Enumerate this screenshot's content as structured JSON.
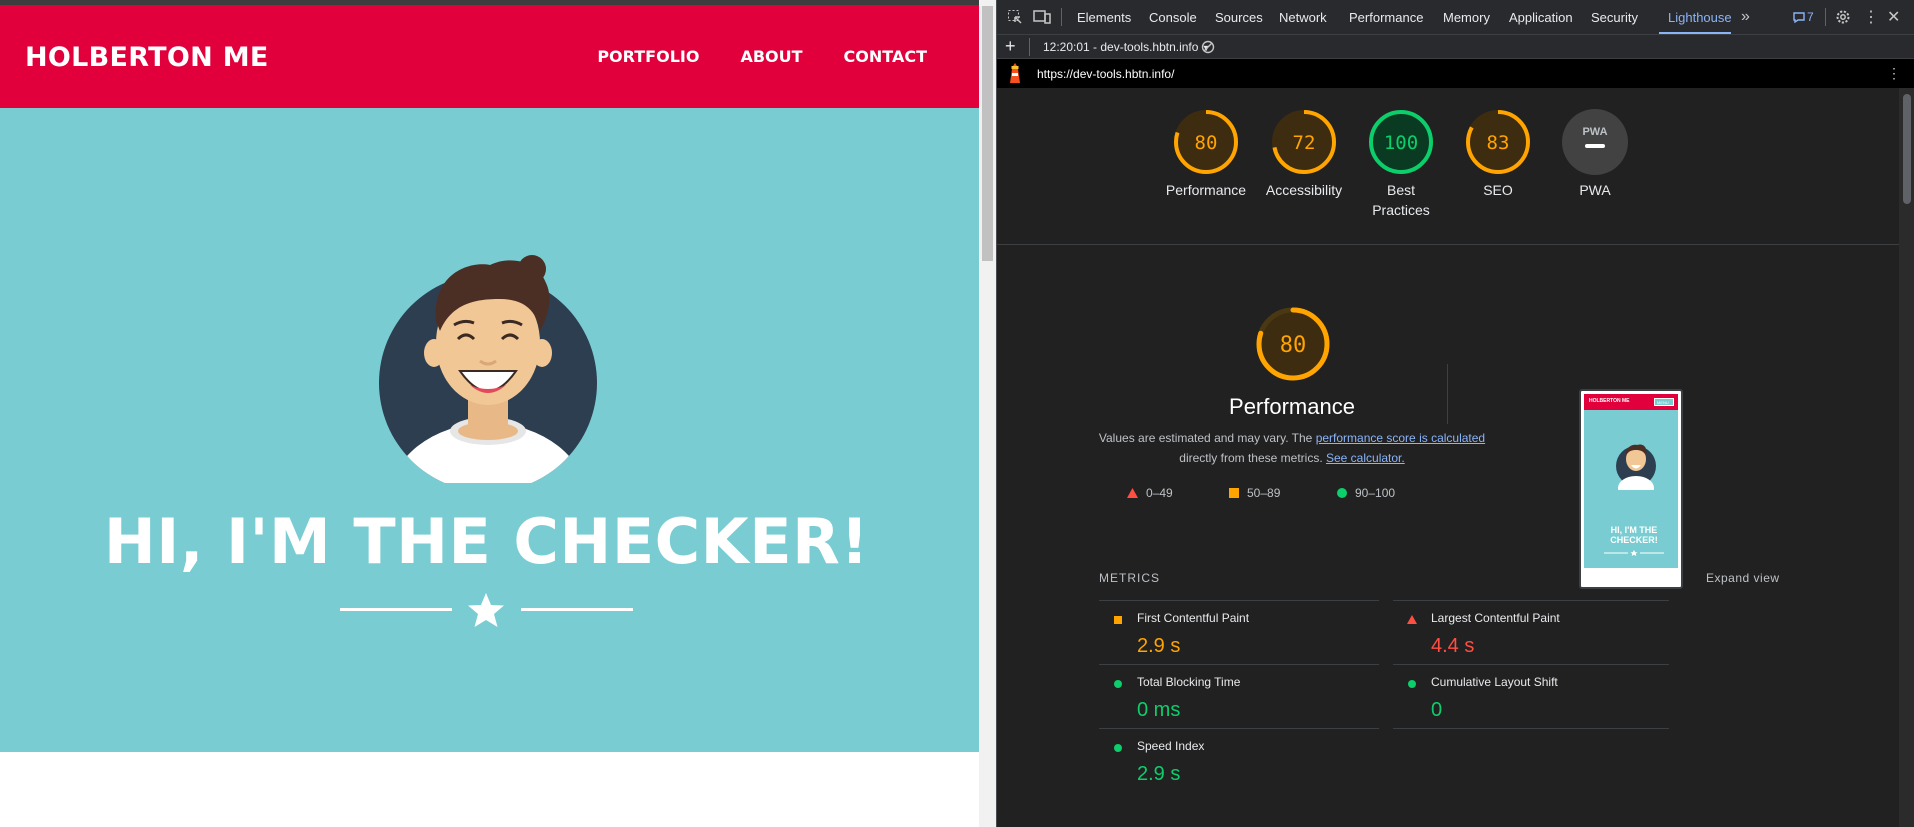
{
  "site": {
    "logo": "HOLBERTON ME",
    "nav": [
      "PORTFOLIO",
      "ABOUT",
      "CONTACT"
    ],
    "hero_title": "HI, I'M THE CHECKER!",
    "colors": {
      "header": "#e1003c",
      "hero": "#79cdd2"
    }
  },
  "devtools": {
    "tabs": [
      "Elements",
      "Console",
      "Sources",
      "Network",
      "Performance",
      "Memory",
      "Application",
      "Security",
      "Lighthouse"
    ],
    "active_tab": "Lighthouse",
    "issues_count": "7",
    "report_label": "12:20:01 - dev-tools.hbtn.info",
    "url": "https://dev-tools.hbtn.info/"
  },
  "lighthouse": {
    "gauges": [
      {
        "label": "Performance",
        "score": 80,
        "color": "#ffa400"
      },
      {
        "label": "Accessibility",
        "score": 72,
        "color": "#ffa400"
      },
      {
        "label": "Best Practices",
        "score": 100,
        "color": "#0cce6b"
      },
      {
        "label": "SEO",
        "score": 83,
        "color": "#ffa400"
      },
      {
        "label": "PWA",
        "score": null,
        "color": "#bdc1c6",
        "badge": "PWA"
      }
    ],
    "perf_score": 80,
    "perf_title": "Performance",
    "desc_prefix": "Values are estimated and may vary. The",
    "desc_link1": "performance score is calculated",
    "desc_mid": "directly from these metrics.",
    "desc_link2": "See calculator.",
    "legend": [
      {
        "range": "0–49",
        "shape": "triangle",
        "color": "#ff4e42"
      },
      {
        "range": "50–89",
        "shape": "square",
        "color": "#ffa400"
      },
      {
        "range": "90–100",
        "shape": "circle",
        "color": "#0cce6b"
      }
    ],
    "thumb": {
      "logo": "HOLBERTON ME",
      "btn": "MENU",
      "title": "HI, I'M THE CHECKER!"
    },
    "metrics_heading": "METRICS",
    "expand_label": "Expand view",
    "metrics": [
      {
        "name": "First Contentful Paint",
        "value": "2.9 s",
        "status": "average",
        "color": "#ffa400"
      },
      {
        "name": "Largest Contentful Paint",
        "value": "4.4 s",
        "status": "fail",
        "color": "#ff4e42"
      },
      {
        "name": "Total Blocking Time",
        "value": "0 ms",
        "status": "pass",
        "color": "#0cce6b"
      },
      {
        "name": "Cumulative Layout Shift",
        "value": "0",
        "status": "pass",
        "color": "#0cce6b"
      },
      {
        "name": "Speed Index",
        "value": "2.9 s",
        "status": "pass",
        "color": "#0cce6b"
      }
    ]
  }
}
